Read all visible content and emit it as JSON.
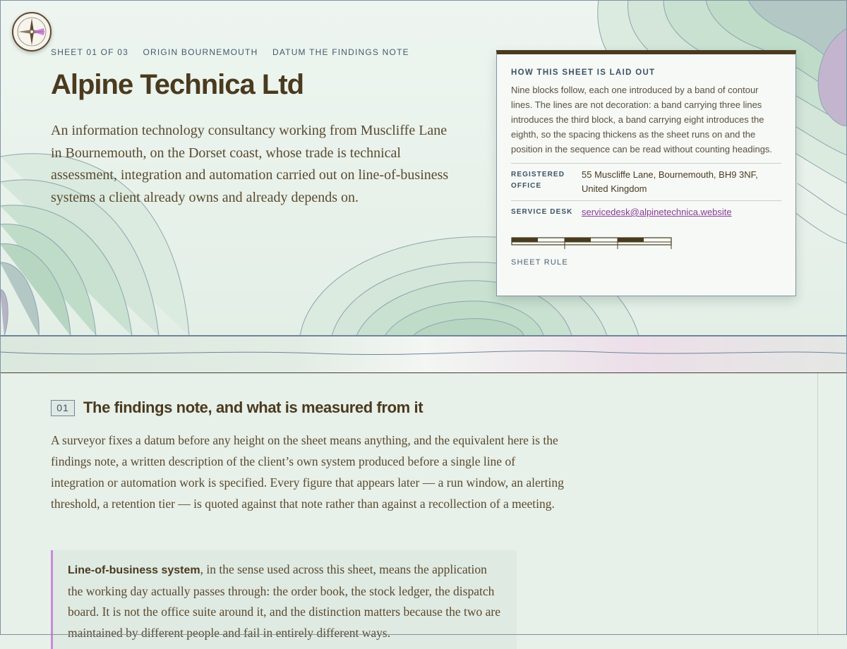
{
  "header": {
    "meta": [
      "SHEET 01 OF 03",
      "ORIGIN BOURNEMOUTH",
      "DATUM THE FINDINGS NOTE"
    ],
    "title": "Alpine Technica Ltd",
    "lede": "An information technology consultancy working from Muscliffe Lane in Bournemouth, on the Dorset coast, whose trade is technical assessment, integration and automation carried out on line-of-business systems a client already owns and already depends on."
  },
  "legend": {
    "title": "HOW THIS SHEET IS LAID OUT",
    "body": "Nine blocks follow, each one introduced by a band of contour lines. The lines are not decoration: a band carrying three lines introduces the third block, a band carrying eight introduces the eighth, so the spacing thickens as the sheet runs on and the position in the sequence can be read without counting headings.",
    "office_label": "REGISTERED OFFICE",
    "office_value": "55 Muscliffe Lane, Bournemouth, BH9 3NF, United Kingdom",
    "desk_label": "SERVICE DESK",
    "desk_value": "servicedesk@alpinetechnica.website",
    "scale_caption": "SHEET RULE"
  },
  "section": {
    "number": "01",
    "title": "The findings note, and what is measured from it",
    "body": "A surveyor fixes a datum before any height on the sheet means anything, and the equivalent here is the findings note, a written description of the client’s own system produced before a single line of integration or automation work is specified. Every figure that appears later — a run window, an alerting threshold, a retention tier — is quoted against that note rather than against a recollection of a meeting.",
    "definition_term": "Line-of-business system",
    "definition_text": ", in the sense used across this sheet, means the application the working day actually passes through: the order book, the stock ledger, the dispatch board. It is not the office suite around it, and the distinction matters because the two are maintained by different people and fail in entirely different ways."
  },
  "colors": {
    "ink": "#4a3a1e",
    "slate": "#3b5266",
    "accent_link": "#8a3a9a",
    "definition_rule": "#c98ad6",
    "page": "#e7f0e9"
  },
  "icons": {
    "compass": "compass-rose-icon"
  }
}
